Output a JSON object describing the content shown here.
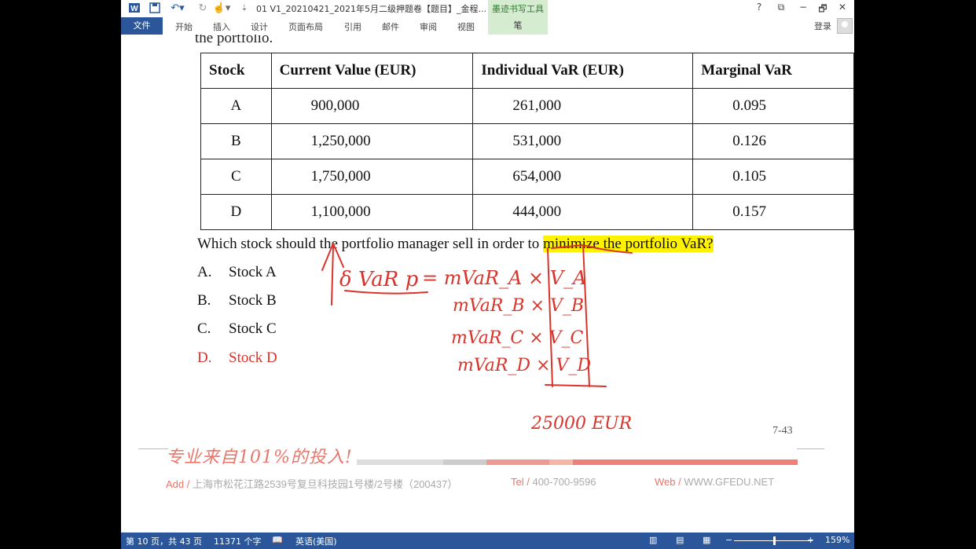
{
  "window": {
    "title": "01 V1_20210421_2021年5月二级押题卷【题目】_金程...",
    "context_tab_group": "墨迹书写工具",
    "help": "?",
    "ribbon_display": "⧉",
    "minimize": "−",
    "restore": "🗗",
    "close": "✕"
  },
  "ribbon": {
    "file": "文件",
    "tabs": [
      "开始",
      "插入",
      "设计",
      "页面布局",
      "引用",
      "邮件",
      "审阅",
      "视图"
    ],
    "ink_tab": "笔",
    "login": "登录"
  },
  "document": {
    "cut_line": "the portfolio.",
    "table": {
      "headers": [
        "Stock",
        "Current Value (EUR)",
        "Individual VaR (EUR)",
        "Marginal VaR"
      ],
      "rows": [
        [
          "A",
          "900,000",
          "261,000",
          "0.095"
        ],
        [
          "B",
          "1,250,000",
          "531,000",
          "0.126"
        ],
        [
          "C",
          "1,750,000",
          "654,000",
          "0.105"
        ],
        [
          "D",
          "1,100,000",
          "444,000",
          "0.157"
        ]
      ]
    },
    "question_start": "Which stock should the portfolio manager sell in order to",
    "question_highlight": "minimize the portfolio VaR",
    "question_end": "?",
    "options": [
      {
        "letter": "A.",
        "text": "Stock A"
      },
      {
        "letter": "B.",
        "text": "Stock B"
      },
      {
        "letter": "C.",
        "text": "Stock C"
      },
      {
        "letter": "D.",
        "text": "Stock D"
      }
    ],
    "page_number": "7-43",
    "ink_annotations": {
      "formula_lhs": "δ VaR p",
      "line_a": "= mVaR_A × V_A",
      "line_b": "mVaR_B × V_B",
      "line_c": "mVaR_C × V_C",
      "line_d": "mVaR_D × V_D",
      "amount": "25000 EUR"
    },
    "footer": {
      "slogan": "专业来自101%的投入!",
      "address_label": "Add /",
      "address": "上海市松花江路2539号复旦科技园1号楼/2号楼（200437）",
      "tel_label": "Tel /",
      "tel": "400-700-9596",
      "web_label": "Web /",
      "web": "WWW.GFEDU.NET"
    }
  },
  "statusbar": {
    "page": "第 10 页，共 43 页",
    "words": "11371 个字",
    "language": "英语(美国)",
    "zoom_minus": "−",
    "zoom_plus": "+",
    "zoom": "159%"
  },
  "colors": {
    "accent": "#2b579a",
    "ink_red": "#d9342b",
    "highlight": "#fff200",
    "brand_red": "#e8776b"
  }
}
